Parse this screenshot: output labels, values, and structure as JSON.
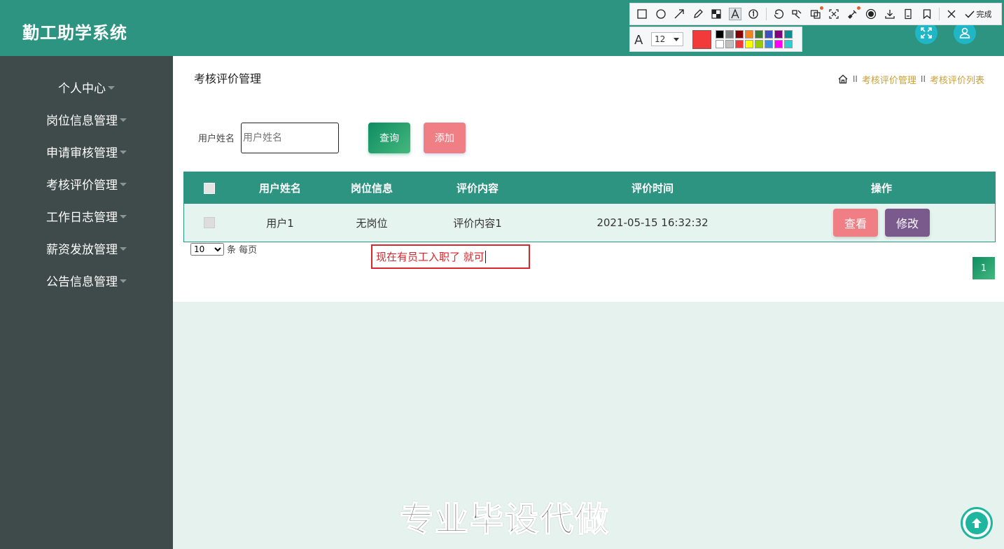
{
  "app": {
    "title": "勤工助学系统"
  },
  "sidebar": {
    "items": [
      {
        "label": "个人中心"
      },
      {
        "label": "岗位信息管理"
      },
      {
        "label": "申请审核管理"
      },
      {
        "label": "考核评价管理"
      },
      {
        "label": "工作日志管理"
      },
      {
        "label": "薪资发放管理"
      },
      {
        "label": "公告信息管理"
      }
    ]
  },
  "page": {
    "title": "考核评价管理",
    "breadcrumb": {
      "separator": "II",
      "items": [
        "考核评价管理",
        "考核评价列表"
      ]
    }
  },
  "search": {
    "label": "用户姓名",
    "placeholder": "用户姓名",
    "value": "",
    "query_label": "查询",
    "add_label": "添加"
  },
  "table": {
    "columns": [
      "用户姓名",
      "岗位信息",
      "评价内容",
      "评价时间",
      "操作"
    ],
    "rows": [
      {
        "user": "用户1",
        "position": "无岗位",
        "content": "评价内容1",
        "time": "2021-05-15 16:32:32",
        "view": "查看",
        "edit": "修改"
      }
    ]
  },
  "pagination": {
    "page_size": "10",
    "page_size_suffix": "条 每页",
    "current_page": "1"
  },
  "annotation": {
    "text": "现在有员工入职了 就可"
  },
  "toolbar": {
    "done_label": "完成",
    "font_size": "12",
    "current_color": "#f23a3a",
    "palette": [
      "#000000",
      "#808080",
      "#800000",
      "#f58220",
      "#3a7a3a",
      "#3f4fbf",
      "#800080",
      "#0e8f8f",
      "#ffffff",
      "#c0c0c0",
      "#f23a3a",
      "#ffff00",
      "#99cc00",
      "#3f8fdf",
      "#ff00ff",
      "#33cccc"
    ],
    "icons": [
      "rectangle-icon",
      "ellipse-icon",
      "arrow-icon",
      "pencil-icon",
      "mosaic-icon",
      "text-icon",
      "number-icon",
      "undo-icon",
      "pin-icon",
      "ocr-icon",
      "scroll-capture-icon",
      "translate-icon",
      "record-icon",
      "download-icon",
      "long-screenshot-icon",
      "bookmark-icon",
      "close-icon",
      "done-icon"
    ]
  },
  "watermark": {
    "text": "专业毕设代做"
  },
  "colors": {
    "header": "#2e9482",
    "sidebar": "#3f4a4b",
    "accent_gold": "#c9a03a",
    "pink": "#ef7f85",
    "purple": "#7a5a8c"
  }
}
